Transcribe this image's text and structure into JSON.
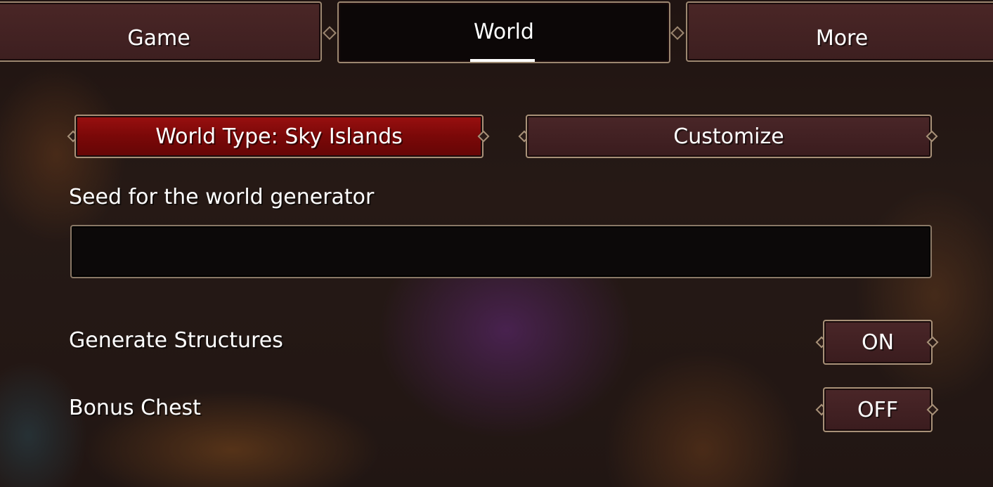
{
  "tabs": [
    {
      "label": "Game",
      "active": false
    },
    {
      "label": "World",
      "active": true
    },
    {
      "label": "More",
      "active": false
    }
  ],
  "world_type_button": {
    "label": "World Type: Sky Islands",
    "selected": true
  },
  "customize_button": {
    "label": "Customize"
  },
  "seed": {
    "label": "Seed for the world generator",
    "value": "",
    "placeholder": ""
  },
  "options": [
    {
      "label": "Generate Structures",
      "value": "ON"
    },
    {
      "label": "Bonus Chest",
      "value": "OFF"
    }
  ],
  "colors": {
    "selected_button": "#7a0808",
    "button": "#3a1c1e",
    "border": "#a89178",
    "text": "#ffffff"
  }
}
